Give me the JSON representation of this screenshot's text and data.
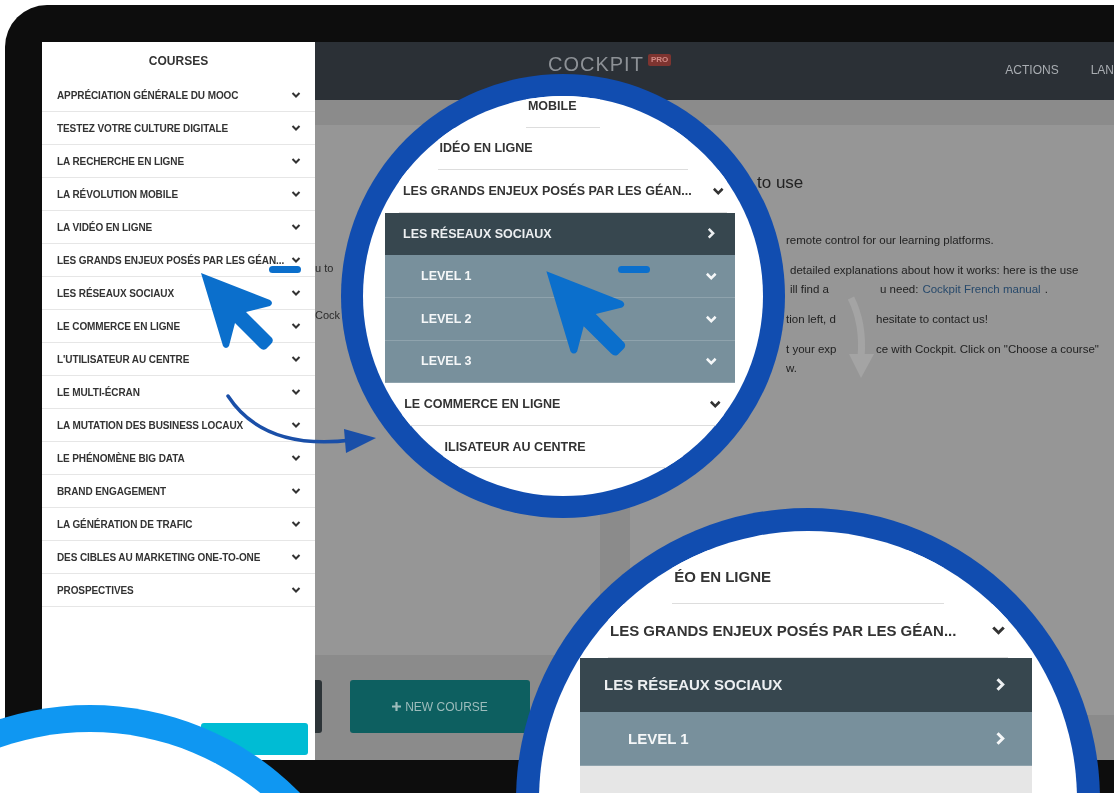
{
  "sidebar": {
    "title": "COURSES",
    "items": [
      {
        "label": "APPRÉCIATION GÉNÉRALE DU MOOC"
      },
      {
        "label": "TESTEZ VOTRE CULTURE DIGITALE"
      },
      {
        "label": "LA RECHERCHE EN LIGNE"
      },
      {
        "label": "LA RÉVOLUTION MOBILE"
      },
      {
        "label": "LA VIDÉO EN LIGNE"
      },
      {
        "label": "LES GRANDS ENJEUX POSÉS PAR LES GÉAN..."
      },
      {
        "label": "LES RÉSEAUX SOCIAUX"
      },
      {
        "label": "LE COMMERCE EN LIGNE"
      },
      {
        "label": "L'UTILISATEUR AU CENTRE"
      },
      {
        "label": "LE MULTI-ÉCRAN"
      },
      {
        "label": "LA MUTATION DES BUSINESS LOCAUX"
      },
      {
        "label": "LE PHÉNOMÈNE BIG DATA"
      },
      {
        "label": "BRAND ENGAGEMENT"
      },
      {
        "label": "LA GÉNÉRATION DE TRAFIC"
      },
      {
        "label": "DES CIBLES AU MARKETING ONE-TO-ONE"
      },
      {
        "label": "PROSPECTIVES"
      }
    ]
  },
  "header": {
    "logo": "COCKPIT",
    "badge": "PRO",
    "nav": [
      "ACTIONS",
      "LAN"
    ]
  },
  "left_card": {
    "fragments": [
      "u to",
      "Cock"
    ]
  },
  "right_card": {
    "title": "to use",
    "paragraphs": [
      [
        [
          {
            "kind": "text",
            "text": "remote control for our learning platforms."
          }
        ]
      ],
      [
        [
          {
            "kind": "text",
            "text": "detailed explanations about how it works: here is the use"
          }
        ],
        [
          {
            "kind": "text",
            "text": "ill find a"
          },
          {
            "kind": "gap"
          },
          {
            "kind": "text",
            "text": "u need:"
          },
          {
            "kind": "link",
            "text": "Cockpit French manual"
          },
          {
            "kind": "text",
            "text": "."
          }
        ]
      ],
      [
        [
          {
            "kind": "text",
            "text": "tion left, d"
          },
          {
            "kind": "gap"
          },
          {
            "kind": "text",
            "text": "hesitate to contact us!"
          }
        ]
      ],
      [
        [
          {
            "kind": "text",
            "text": "t your exp"
          },
          {
            "kind": "gap"
          },
          {
            "kind": "text",
            "text": "ce with Cockpit. Click on \"Choose a course\""
          }
        ],
        [
          {
            "kind": "text",
            "text": "w."
          }
        ]
      ]
    ]
  },
  "new_course_button": {
    "label": "NEW COURSE"
  },
  "magnifier_top": {
    "rows": [
      {
        "kind": "course",
        "label": "MOBILE"
      },
      {
        "kind": "course",
        "label": "IDÉO EN LIGNE"
      },
      {
        "kind": "course",
        "label": "LES GRANDS ENJEUX POSÉS PAR LES GÉAN...",
        "expanded": true
      },
      {
        "kind": "topic",
        "label": "LES RÉSEAUX SOCIAUX",
        "expanded": false
      },
      {
        "kind": "level",
        "label": "LEVEL 1",
        "expanded": true
      },
      {
        "kind": "level",
        "label": "LEVEL 2",
        "expanded": true
      },
      {
        "kind": "level",
        "label": "LEVEL 3",
        "expanded": true
      },
      {
        "kind": "course",
        "label": "LE COMMERCE EN LIGNE",
        "expanded": true
      },
      {
        "kind": "course",
        "label": "ILISATEUR AU CENTRE"
      }
    ]
  },
  "magnifier_bottom": {
    "rows": [
      {
        "kind": "course",
        "label": "ÉO EN LIGNE"
      },
      {
        "kind": "course",
        "label": "LES GRANDS ENJEUX POSÉS PAR LES GÉAN...",
        "expanded": true
      },
      {
        "kind": "topic",
        "label": "LES RÉSEAUX SOCIAUX",
        "expanded": false
      },
      {
        "kind": "level",
        "label": "LEVEL 1",
        "expanded": false
      }
    ]
  }
}
